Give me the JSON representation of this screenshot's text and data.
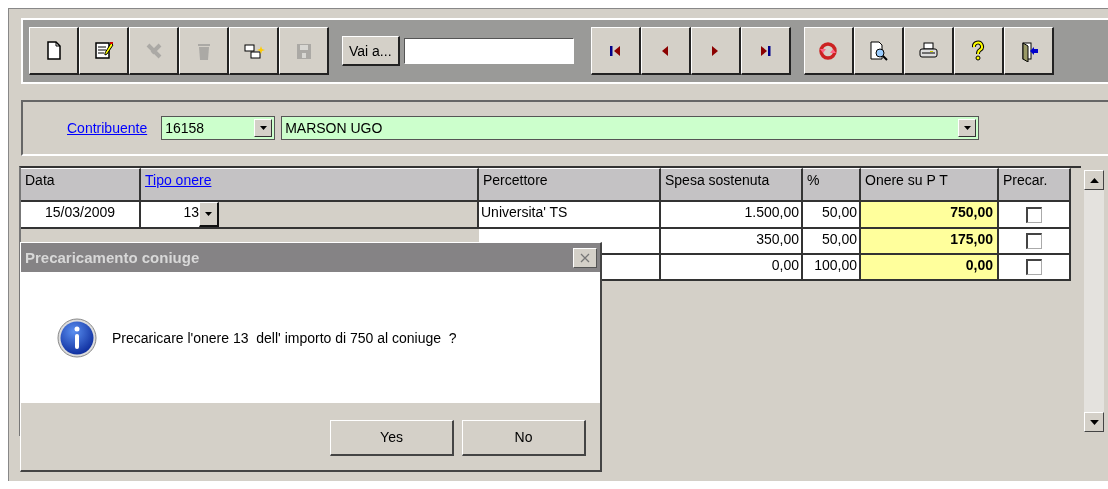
{
  "toolbar": {
    "groups": [
      [
        {
          "kind": "new",
          "disabled": false
        },
        {
          "kind": "edit",
          "disabled": false
        },
        {
          "kind": "cancel",
          "disabled": true
        },
        {
          "kind": "delete",
          "disabled": true
        },
        {
          "kind": "copy",
          "disabled": false
        },
        {
          "kind": "save",
          "disabled": true
        }
      ],
      [
        {
          "kind": "first",
          "disabled": false
        },
        {
          "kind": "prev",
          "disabled": false
        },
        {
          "kind": "next",
          "disabled": false
        },
        {
          "kind": "last",
          "disabled": false
        }
      ],
      [
        {
          "kind": "refresh",
          "disabled": false
        },
        {
          "kind": "preview",
          "disabled": false
        },
        {
          "kind": "print",
          "disabled": false
        },
        {
          "kind": "help",
          "disabled": false
        },
        {
          "kind": "exit",
          "disabled": false
        }
      ]
    ],
    "goto_button": "Vai a..."
  },
  "contribuente": {
    "label": "Contribuente",
    "code": "16158",
    "name": "MARSON UGO"
  },
  "table": {
    "columns": [
      {
        "label": "Data",
        "link": false
      },
      {
        "label": "Tipo onere",
        "link": true
      },
      {
        "label": "Percettore",
        "link": false
      },
      {
        "label": "Spesa sostenuta",
        "link": false
      },
      {
        "label": "%",
        "link": false
      },
      {
        "label": "Onere su P T",
        "link": false
      },
      {
        "label": "Precar.",
        "link": false
      }
    ],
    "rows": [
      {
        "data": "15/03/2009",
        "tipo": "13",
        "percettore": "Universita' TS",
        "spesa": "1.500,00",
        "percent": "50,00",
        "onere": "750,00",
        "precar": false
      },
      {
        "spesa": "350,00",
        "percent": "50,00",
        "onere": "175,00",
        "precar": false
      },
      {
        "spesa": "0,00",
        "percent": "100,00",
        "onere": "0,00",
        "precar": false
      }
    ]
  },
  "dialog": {
    "title": "Precaricamento coniuge",
    "message": "Precaricare l'onere 13  dell' importo di 750 al coniuge  ?",
    "buttons": [
      "Yes",
      "No"
    ]
  }
}
